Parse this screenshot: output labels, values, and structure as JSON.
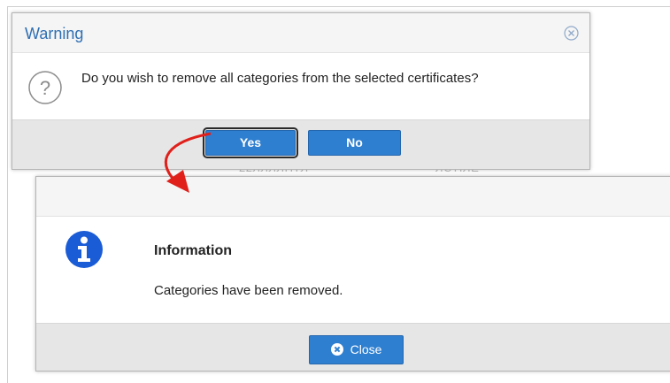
{
  "background": {
    "ghost_text_1": "22ЛЛЛЛПТЛ",
    "ghost_text_2": "ЛСТІЛЕ"
  },
  "warning_dialog": {
    "title": "Warning",
    "close_icon": "circle-x-icon",
    "message_icon": "question-circle-icon",
    "message": "Do you wish to remove all categories from the selected certificates?",
    "buttons": {
      "yes_label": "Yes",
      "no_label": "No"
    }
  },
  "annotation": {
    "arrow_icon": "curved-red-arrow",
    "arrow_color": "#e0201b"
  },
  "info_dialog": {
    "icon": "info-circle-icon",
    "title": "Information",
    "message": "Categories have been removed.",
    "close_label": "Close",
    "close_icon": "circle-x-icon"
  },
  "colors": {
    "accent": "#2f7fd0",
    "title_blue": "#2f6fb3",
    "info_icon": "#1a5bd6",
    "footer_bg": "#e6e6e6"
  }
}
